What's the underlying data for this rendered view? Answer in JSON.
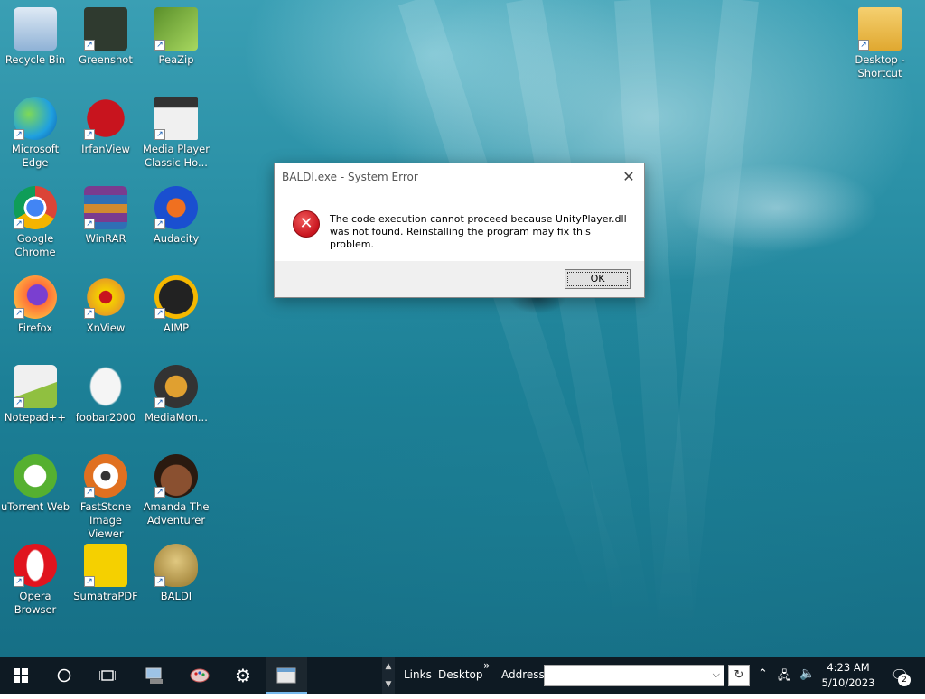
{
  "desktop_icons": [
    {
      "label": "Recycle Bin",
      "icon": "recycle-bin-icon",
      "color": "#9dc3e6"
    },
    {
      "label": "Greenshot",
      "icon": "greenshot-icon",
      "color": "#2f3a2f"
    },
    {
      "label": "PeaZip",
      "icon": "peazip-icon",
      "color": "#8cc63f"
    },
    {
      "label": "Microsoft Edge",
      "icon": "edge-icon",
      "color": "#1fa0e0"
    },
    {
      "label": "IrfanView",
      "icon": "irfanview-icon",
      "color": "#c8141e"
    },
    {
      "label": "Media Player Classic Ho...",
      "icon": "media-player-classic-icon",
      "color": "#e8e8e8"
    },
    {
      "label": "Google Chrome",
      "icon": "chrome-icon",
      "color": "#db4437"
    },
    {
      "label": "WinRAR",
      "icon": "winrar-icon",
      "color": "#7a3b8f"
    },
    {
      "label": "Audacity",
      "icon": "audacity-icon",
      "color": "#1a4fd0"
    },
    {
      "label": "Firefox",
      "icon": "firefox-icon",
      "color": "#ff7139"
    },
    {
      "label": "XnView",
      "icon": "xnview-icon",
      "color": "#e8a020"
    },
    {
      "label": "AIMP",
      "icon": "aimp-icon",
      "color": "#f5b800"
    },
    {
      "label": "Notepad++",
      "icon": "notepadpp-icon",
      "color": "#90c040"
    },
    {
      "label": "foobar2000",
      "icon": "foobar2000-icon",
      "color": "#f0f0f0"
    },
    {
      "label": "MediaMon...",
      "icon": "mediamonkey-icon",
      "color": "#e0a030"
    },
    {
      "label": "uTorrent Web",
      "icon": "utorrent-icon",
      "color": "#55b030"
    },
    {
      "label": "FastStone Image Viewer",
      "icon": "faststone-icon",
      "color": "#e07020"
    },
    {
      "label": "Amanda The Adventurer",
      "icon": "amanda-icon",
      "color": "#6b3a20"
    },
    {
      "label": "Opera Browser",
      "icon": "opera-icon",
      "color": "#e0141e"
    },
    {
      "label": "SumatraPDF",
      "icon": "sumatrapdf-icon",
      "color": "#f5d000"
    },
    {
      "label": "BALDI",
      "icon": "baldi-icon",
      "color": "#c8b060"
    },
    {
      "label": "Desktop - Shortcut",
      "icon": "folder-shortcut-icon",
      "color": "#f0c040"
    }
  ],
  "dialog": {
    "title": "BALDI.exe - System Error",
    "message_line1": "The code execution cannot proceed because UnityPlayer.dll",
    "message_line2": "was not found. Reinstalling the program may fix this problem.",
    "ok_label": "OK",
    "close_glyph": "✕",
    "error_glyph": "✕"
  },
  "taskbar": {
    "toolbar_links": "Links",
    "toolbar_desktop": "Desktop",
    "toolbar_more": "»",
    "address_label": "Address",
    "address_value": "",
    "time": "4:23 AM",
    "date": "5/10/2023",
    "notification_count": "2",
    "accent": "#76b9ed"
  }
}
